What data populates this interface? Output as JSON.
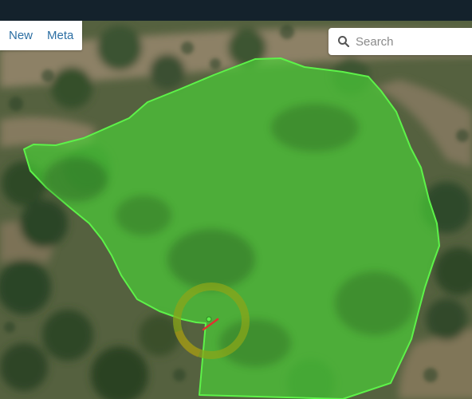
{
  "menu": {
    "new_label": "New",
    "meta_label": "Meta"
  },
  "search": {
    "placeholder": "Search",
    "value": ""
  },
  "map": {
    "layer": "satellite-imagery",
    "polygon_fill_color": "#4cd139",
    "polygon_stroke_color": "#5df249",
    "selection_ring_color": "#8aa51a",
    "direction_marker_color": "#e03030"
  },
  "icons": {
    "search": "magnifier-icon"
  }
}
